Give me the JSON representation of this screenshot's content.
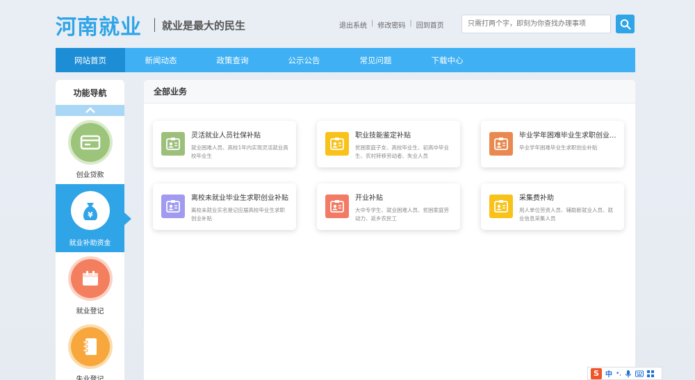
{
  "header": {
    "logo": "河南就业",
    "slogan": "就业是最大的民生",
    "links": [
      "退出系统",
      "修改密码",
      "回到首页"
    ],
    "link_separator": "|",
    "search_placeholder": "只需打两个字，即刻为你查找办理事项"
  },
  "nav": {
    "items": [
      "网站首页",
      "新闻动态",
      "政策查询",
      "公示公告",
      "常见问题",
      "下载中心"
    ],
    "active_index": 0
  },
  "sidebar": {
    "title": "功能导航",
    "items": [
      {
        "label": "创业贷款",
        "icon": "card-icon",
        "color": "#9cc47a"
      },
      {
        "label": "就业补助资金",
        "icon": "money-bag-icon",
        "color": "#2fa4e7"
      },
      {
        "label": "就业登记",
        "icon": "calendar-icon",
        "color": "#f37f5f"
      },
      {
        "label": "失业登记",
        "icon": "notebook-icon",
        "color": "#f7a73c"
      }
    ],
    "active_index": 1
  },
  "main": {
    "title": "全部业务",
    "cards": [
      {
        "title": "灵活就业人员社保补贴",
        "desc": "就业困难人员、高校1年内实现灵活就业高校毕业生",
        "color": "#9cbf7c"
      },
      {
        "title": "职业技能鉴定补贴",
        "desc": "贫困家庭子女、高校毕业生、初高中毕业生、农村转移劳动者、失业人员",
        "color": "#f8c21a"
      },
      {
        "title": "毕业学年困难毕业生求职创业...",
        "desc": "毕业学年困难毕业生求职创业补贴",
        "color": "#e9894f"
      },
      {
        "title": "离校未就业毕业生求职创业补贴",
        "desc": "离校未就业实名登记应届高校毕业生求职创业补贴",
        "color": "#a09bf1"
      },
      {
        "title": "开业补贴",
        "desc": "大中专学生、就业困难人员、贫困家庭劳动力、返乡农民工",
        "color": "#f37a64"
      },
      {
        "title": "采集费补助",
        "desc": "用人单位劳资人员、辅助新就业人员、就业信息采集人员",
        "color": "#f8c21a"
      }
    ]
  },
  "ime": {
    "logo": "S",
    "mode": "中",
    "punct": "•,"
  }
}
